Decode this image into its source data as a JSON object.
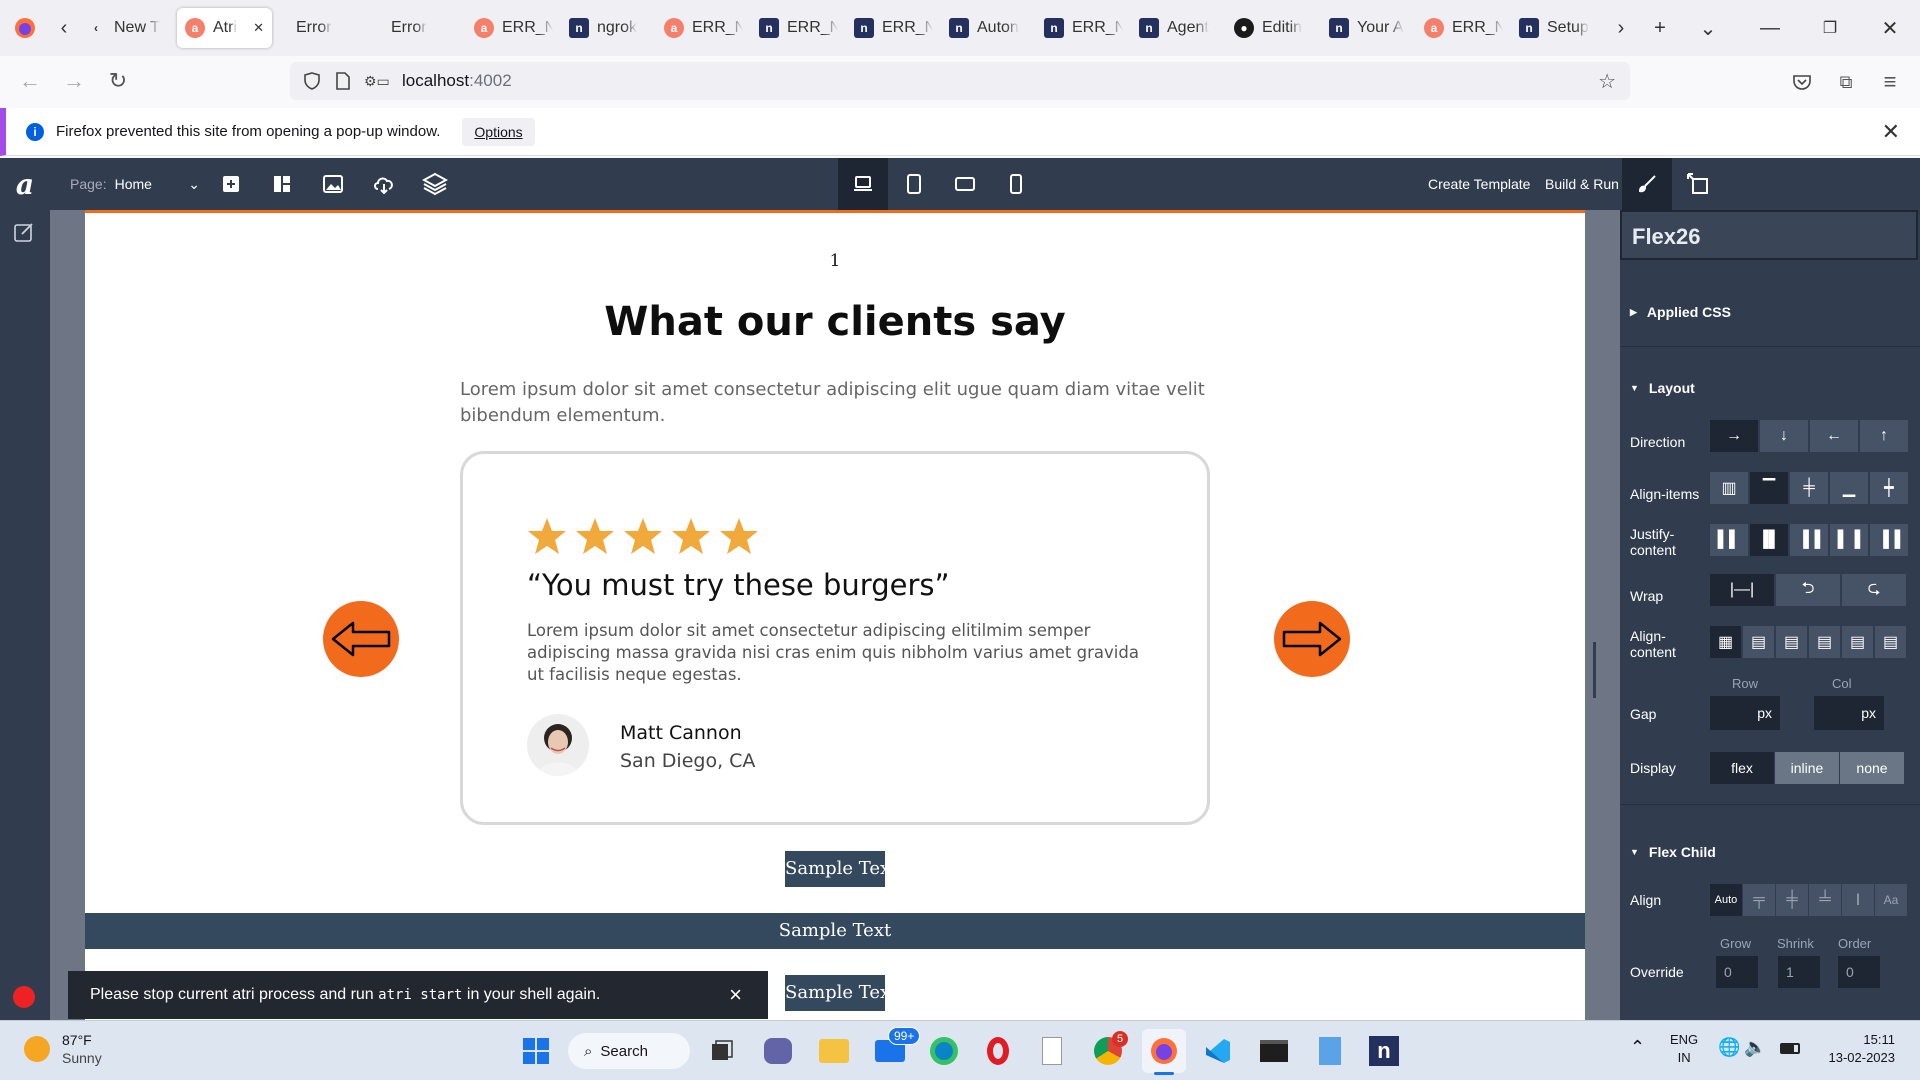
{
  "browser": {
    "tabs": [
      {
        "label": "New T",
        "icon": "generic-page-icon"
      },
      {
        "label": "Atri",
        "icon": "atri-icon",
        "active": true
      },
      {
        "label": "Error",
        "icon": "none"
      },
      {
        "label": "Error",
        "icon": "none"
      },
      {
        "label": "ERR_N",
        "icon": "atri-icon"
      },
      {
        "label": "ngrok",
        "icon": "n-icon"
      },
      {
        "label": "ERR_N",
        "icon": "atri-icon"
      },
      {
        "label": "ERR_N",
        "icon": "n-icon"
      },
      {
        "label": "ERR_N",
        "icon": "n-icon"
      },
      {
        "label": "Auton",
        "icon": "n-icon"
      },
      {
        "label": "ERR_N",
        "icon": "n-icon"
      },
      {
        "label": "Agent",
        "icon": "n-icon"
      },
      {
        "label": "Editin",
        "icon": "github-icon"
      },
      {
        "label": "Your A",
        "icon": "n-icon"
      },
      {
        "label": "ERR_N",
        "icon": "atri-icon"
      },
      {
        "label": "Setup",
        "icon": "n-icon"
      }
    ],
    "url_host": "localhost",
    "url_port": ":4002",
    "notice_text": "Firefox prevented this site from opening a pop-up window.",
    "notice_button": "Options"
  },
  "editor": {
    "page_label": "Page:",
    "page_value": "Home",
    "create_template": "Create Template",
    "build_run": "Build & Run"
  },
  "canvas": {
    "page_number": "1",
    "heading": "What our clients say",
    "subtext": "Lorem ipsum dolor sit amet consectetur adipiscing elit ugue quam diam vitae velit bibendum elementum.",
    "star_count": 5,
    "star_color": "#f2a93b",
    "quote": "“You must try these burgers”",
    "body": "Lorem ipsum dolor sit amet consectetur adipiscing elitilmim semper adipiscing massa gravida nisi cras enim quis nibholm varius amet gravida ut facilisis neque egestas.",
    "author_name": "Matt Cannon",
    "author_location": "San Diego, CA",
    "sample_text_1": "Sample Text",
    "sample_text_2": "Sample Text",
    "sample_text_3": "Sample Text",
    "arrow_color": "#f26b1d"
  },
  "toast": {
    "text_before": "Please stop current atri process and run ",
    "code": "atri start",
    "text_after": " in your shell again.",
    "close": "×"
  },
  "panel": {
    "component_name": "Flex26",
    "applied_css": "Applied CSS",
    "layout": "Layout",
    "direction": "Direction",
    "align_items": "Align-items",
    "justify_content_1": "Justify-",
    "justify_content_2": "content",
    "wrap": "Wrap",
    "align_content_1": "Align-",
    "align_content_2": "content",
    "row": "Row",
    "col": "Col",
    "gap": "Gap",
    "px": "px",
    "display": "Display",
    "display_options": [
      "flex",
      "inline",
      "none"
    ],
    "flex_child": "Flex Child",
    "align": "Align",
    "align_auto": "Auto",
    "grow": "Grow",
    "shrink": "Shrink",
    "order": "Order",
    "override": "Override",
    "grow_value": "0",
    "shrink_value": "1",
    "order_value": "0"
  },
  "taskbar": {
    "weather_temp": "87°F",
    "weather_desc": "Sunny",
    "search": "Search",
    "mail_badge": "99+",
    "chrome_badge": "5",
    "lang1": "ENG",
    "lang2": "IN",
    "time": "15:11",
    "date": "13-02-2023"
  }
}
